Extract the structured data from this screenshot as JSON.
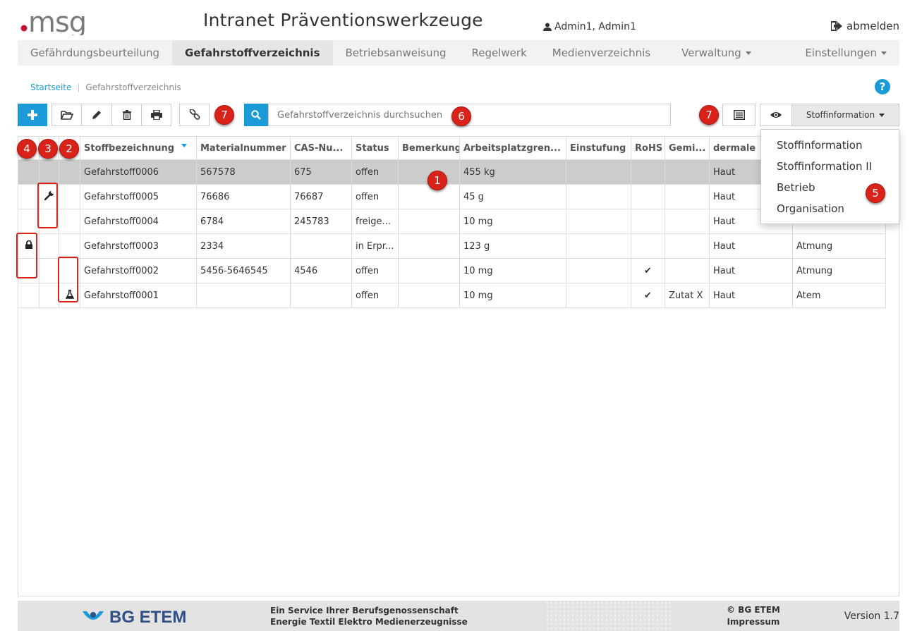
{
  "header": {
    "logo_text": ".msg",
    "title": "Intranet Präventionswerkzeuge",
    "user": "Admin1, Admin1",
    "logout": "abmelden"
  },
  "nav": {
    "items": [
      {
        "label": "Gefährdungsbeurteilung"
      },
      {
        "label": "Gefahrstoffverzeichnis"
      },
      {
        "label": "Betriebsanweisung"
      },
      {
        "label": "Regelwerk"
      },
      {
        "label": "Medienverzeichnis"
      },
      {
        "label": "Verwaltung"
      },
      {
        "label": "Einstellungen"
      }
    ],
    "active": "Gefahrstoffverzeichnis"
  },
  "breadcrumb": {
    "home": "Startseite",
    "separator": "|",
    "current": "Gefahrstoffverzeichnis"
  },
  "help": "?",
  "search": {
    "placeholder": "Gefahrstoffverzeichnis durchsuchen"
  },
  "view_select": {
    "selected": "Stoffinformation"
  },
  "dropdown": {
    "items": [
      "Stoffinformation",
      "Stoffinformation II",
      "Betrieb",
      "Organisation"
    ]
  },
  "badges": {
    "b1": "1",
    "b2": "2",
    "b3": "3",
    "b4": "4",
    "b5": "5",
    "b6": "6",
    "b7": "7"
  },
  "table": {
    "columns": [
      "Stoffbezeichnung",
      "Materialnummer",
      "CAS-Nu...",
      "Status",
      "Bemerkung",
      "Arbeitsplatzgren...",
      "Einstufung",
      "RoHS",
      "Gemi...",
      "dermale",
      ""
    ],
    "rows": [
      {
        "lock": false,
        "wrench": false,
        "flask": false,
        "cells": [
          "Gefahrstoff0006",
          "567578",
          "675",
          "offen",
          "",
          "455 kg",
          "",
          "",
          "",
          "Haut",
          ""
        ]
      },
      {
        "lock": false,
        "wrench": true,
        "flask": false,
        "cells": [
          "Gefahrstoff0005",
          "76686",
          "76687",
          "offen",
          "",
          "45 g",
          "",
          "",
          "",
          "Haut",
          ""
        ]
      },
      {
        "lock": false,
        "wrench": false,
        "flask": false,
        "cells": [
          "Gefahrstoff0004",
          "6784",
          "245783",
          "freige...",
          "",
          "10 mg",
          "",
          "",
          "",
          "Haut",
          ""
        ]
      },
      {
        "lock": true,
        "wrench": false,
        "flask": false,
        "cells": [
          "Gefahrstoff0003",
          "2334",
          "",
          "in Erpr...",
          "",
          "123 g",
          "",
          "",
          "",
          "Haut",
          "Atmung"
        ]
      },
      {
        "lock": false,
        "wrench": false,
        "flask": false,
        "cells": [
          "Gefahrstoff0002",
          "5456-5646545",
          "4546",
          "offen",
          "",
          "10 mg",
          "",
          "✔",
          "",
          "Haut",
          "Atmung"
        ]
      },
      {
        "lock": false,
        "wrench": false,
        "flask": true,
        "cells": [
          "Gefahrstoff0001",
          "",
          "",
          "offen",
          "",
          "10 mg",
          "",
          "✔",
          "Zutat X",
          "Haut",
          "Atem"
        ]
      }
    ]
  },
  "footer": {
    "brand": "BG ETEM",
    "service_line1": "Ein Service Ihrer Berufsgenossenschaft",
    "service_line2": "Energie Textil Elektro Medienerzeugnisse",
    "copyright": "© BG ETEM",
    "impressum": "Impressum",
    "version": "Version 1.7"
  },
  "colors": {
    "accent": "#1a9bd7",
    "badge": "#d8221a",
    "brand": "#2f4f86"
  }
}
